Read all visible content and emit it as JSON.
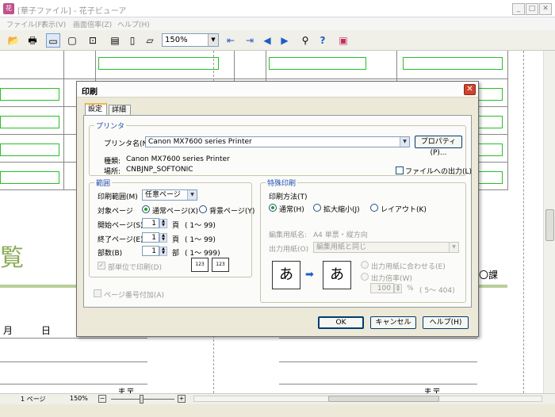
{
  "window": {
    "title": "[華子ファイル] - 花子ビューア",
    "minimize": "_",
    "maximize": "□",
    "close": "✕"
  },
  "menu": [
    "ファイル(F)",
    "表示(V)",
    "画面倍率(Z)",
    "ヘルプ(H)"
  ],
  "toolbar": {
    "zoom": "150%"
  },
  "document": {
    "heading_char": "覧",
    "month": "月",
    "day": "日",
    "course": "〇課",
    "maru_left": "ま〒",
    "maru_right": "ま〒"
  },
  "status": {
    "page": "1 ページ",
    "zoom": "150%",
    "zoom_minus": "−",
    "zoom_plus": "+"
  },
  "dialog": {
    "title": "印刷",
    "close": "✕",
    "tabs": [
      "設定",
      "詳細"
    ],
    "printer_group": "プリンタ",
    "printer_label": "プリンタ名(N)",
    "printer_value": "Canon MX7600 series Printer",
    "properties_button": "プロパティ(P)...",
    "type_label": "種類:",
    "type_value": "Canon MX7600 series Printer",
    "location_label": "場所:",
    "location_value": "CNBJNP_SOFTONIC",
    "print_to_file": "ファイルへの出力(L)",
    "range_group": "範囲",
    "range_label": "印刷範囲(M)",
    "range_value": "任意ページ",
    "target_label": "対象ページ",
    "target_normal": "通常ページ(X)",
    "target_background": "背景ページ(Y)",
    "start_label": "開始ページ(S)",
    "start_value": "1",
    "end_label": "終了ページ(E)",
    "end_value": "1",
    "copies_label": "部数(B)",
    "copies_value": "1",
    "unit_page": "頁",
    "unit_copies": "部",
    "start_range": "( 1〜 99)",
    "end_range": "( 1〜 99)",
    "copies_range": "( 1〜 999)",
    "collate": "部単位で印刷(D)",
    "page_number": "ページ番号付加(A)",
    "special_group": "特殊印刷",
    "method_label": "印刷方法(T)",
    "method_normal": "通常(H)",
    "method_scale": "拡大縮小(J)",
    "method_layout": "レイアウト(K)",
    "edit_paper_label": "編集用紙名:",
    "edit_paper_value": "A4 単票・縦方向",
    "output_paper_label": "出力用紙(O)",
    "output_paper_value": "編集用紙と同じ",
    "fit_paper": "出力用紙に合わせる(E)",
    "output_scale": "出力倍率(W)",
    "scale_value": "100",
    "scale_unit": "%",
    "scale_range": "( 5〜 404)",
    "preview_char": "あ",
    "arrow": "➡",
    "ok_button": "OK",
    "cancel_button": "キャンセル",
    "help_button": "ヘルプ(H)"
  },
  "colors": {
    "accent": "#f6b73c",
    "green": "#28c028",
    "group_label": "#1f4fb0",
    "close_red": "#d0432a"
  }
}
